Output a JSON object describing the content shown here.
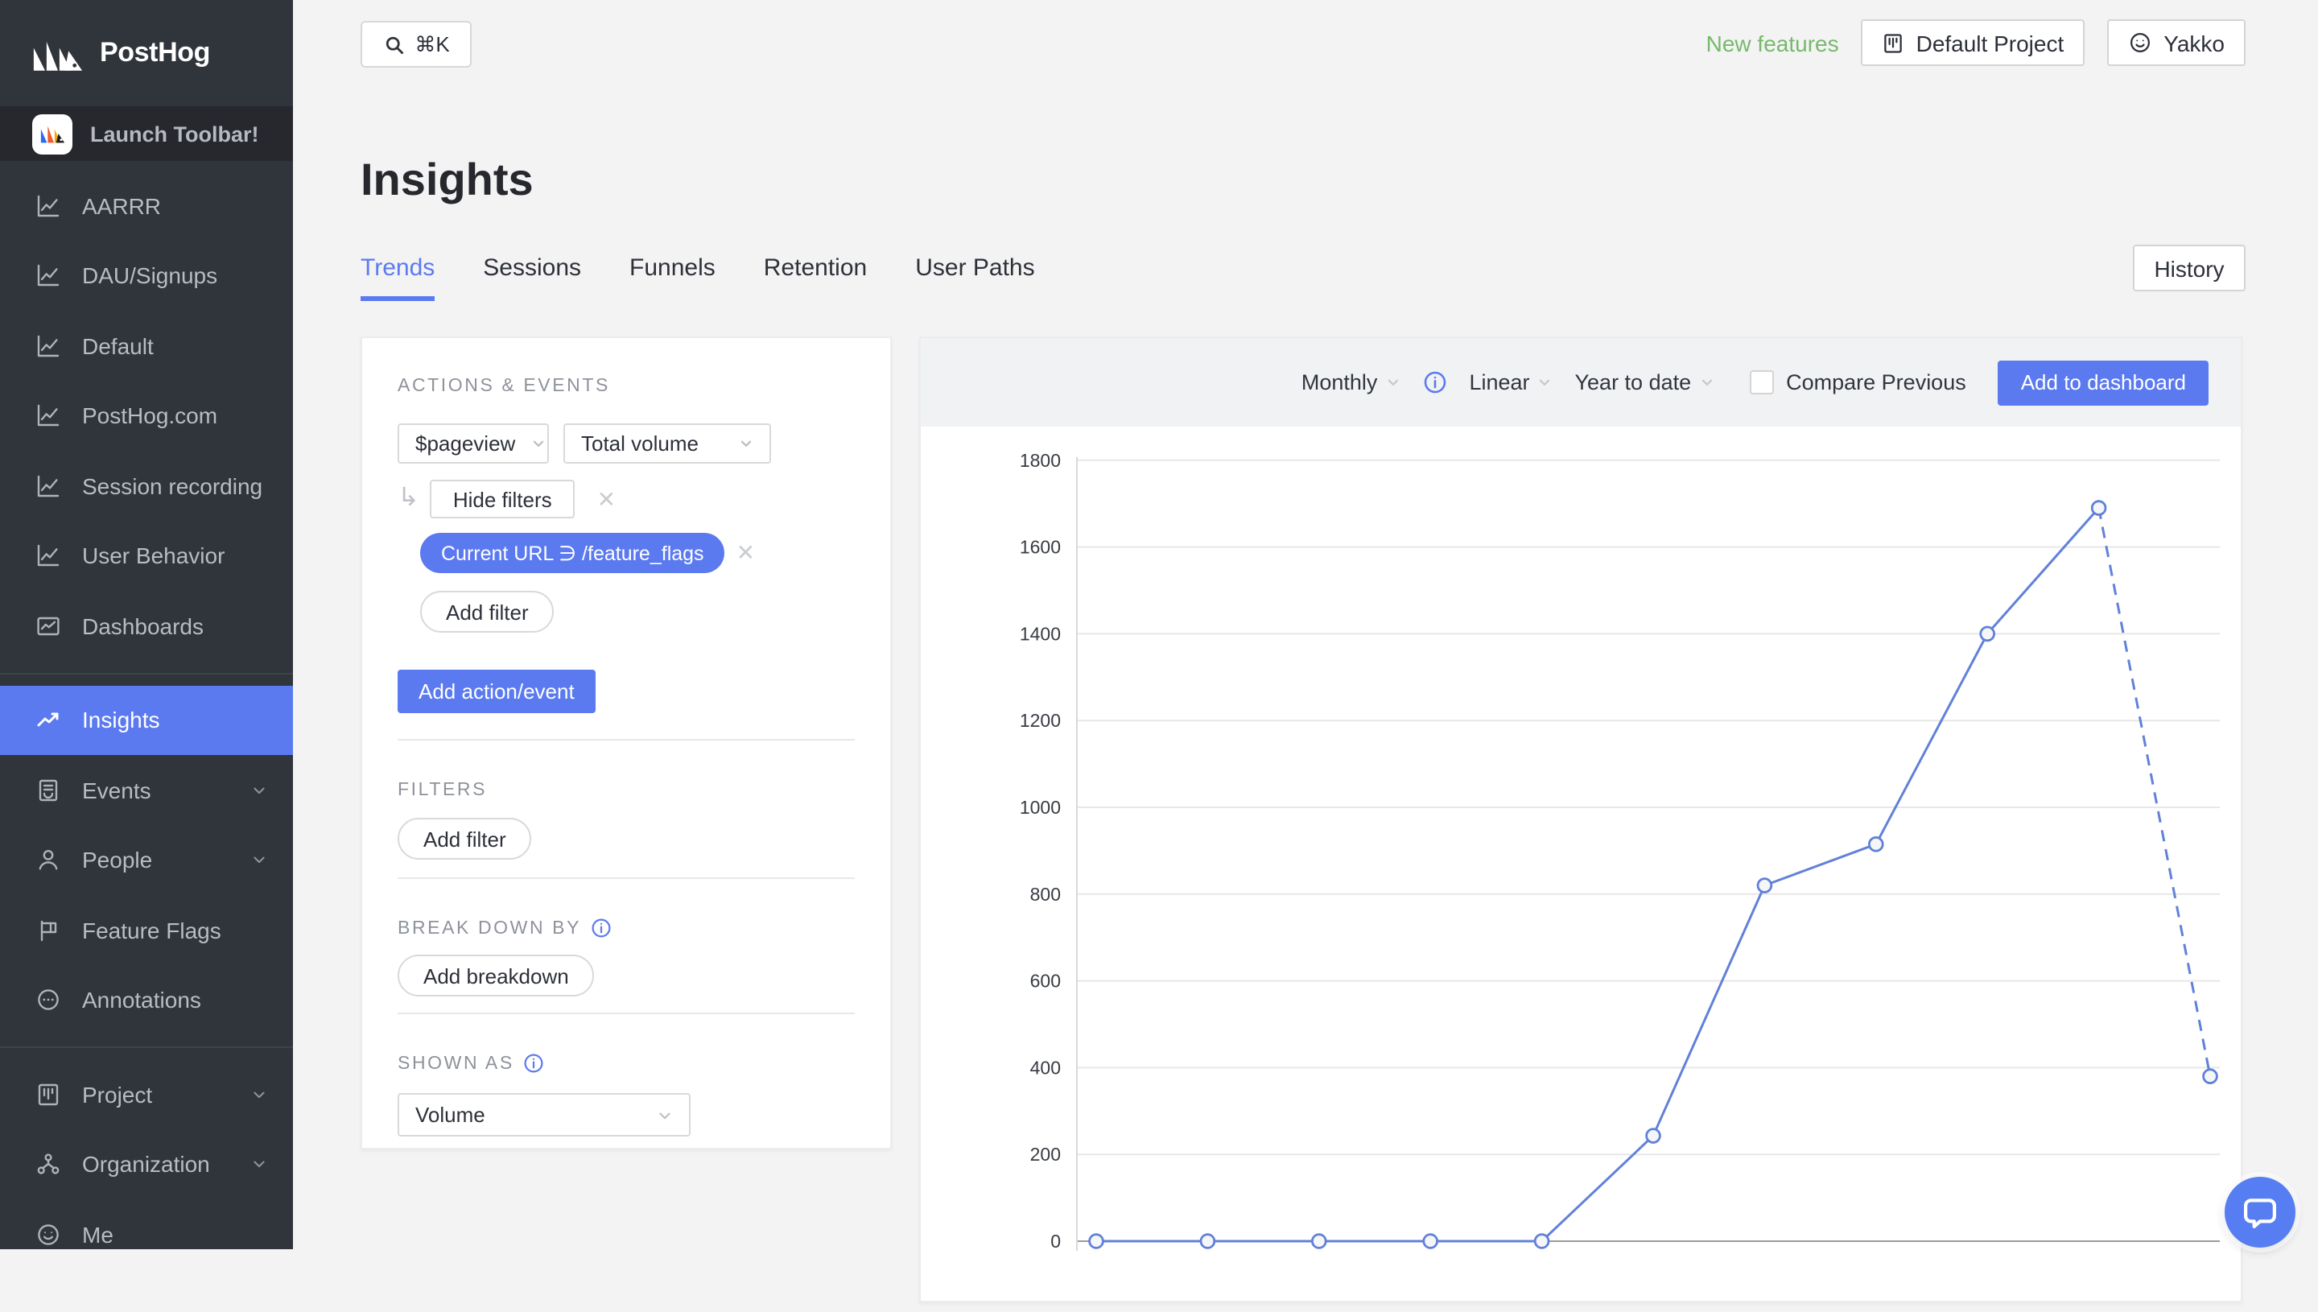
{
  "colors": {
    "accent": "#5b7af0",
    "line": "#6181d9",
    "green": "#77b96b",
    "sidebar_bg": "#30343b",
    "page_bg": "#f3f3f4"
  },
  "app": {
    "logo_text": "PostHog"
  },
  "topbar": {
    "search_shortcut": "⌘K",
    "new_features": "New features",
    "project_button": "Default Project",
    "user_button": "Yakko"
  },
  "sidebar": {
    "launch_toolbar": "Launch Toolbar!",
    "groups": [
      [
        {
          "label": "AARRR",
          "icon": "line-chart"
        },
        {
          "label": "DAU/Signups",
          "icon": "line-chart"
        },
        {
          "label": "Default",
          "icon": "line-chart"
        },
        {
          "label": "PostHog.com",
          "icon": "line-chart"
        },
        {
          "label": "Session recording",
          "icon": "line-chart"
        },
        {
          "label": "User Behavior",
          "icon": "line-chart"
        },
        {
          "label": "Dashboards",
          "icon": "dashboard"
        }
      ],
      [
        {
          "label": "Insights",
          "icon": "trending-up",
          "active": true
        },
        {
          "label": "Events",
          "icon": "container",
          "chevron": true
        },
        {
          "label": "People",
          "icon": "user",
          "chevron": true
        },
        {
          "label": "Feature Flags",
          "icon": "flag"
        },
        {
          "label": "Annotations",
          "icon": "comment"
        }
      ],
      [
        {
          "label": "Project",
          "icon": "project",
          "chevron": true
        },
        {
          "label": "Organization",
          "icon": "cluster",
          "chevron": true
        },
        {
          "label": "Me",
          "icon": "smile"
        }
      ]
    ]
  },
  "page": {
    "title": "Insights",
    "tabs": [
      {
        "label": "Trends",
        "active": true
      },
      {
        "label": "Sessions"
      },
      {
        "label": "Funnels"
      },
      {
        "label": "Retention"
      },
      {
        "label": "User Paths"
      }
    ],
    "history_button": "History"
  },
  "panel": {
    "actions_events_label": "ACTIONS & EVENTS",
    "event_select": "$pageview",
    "math_select": "Total volume",
    "hide_filters": "Hide filters",
    "filter_chip": "Current URL ∋ /feature_flags",
    "add_filter": "Add filter",
    "add_action_event": "Add action/event",
    "filters_label": "FILTERS",
    "add_filter_2": "Add filter",
    "breakdown_label": "BREAK DOWN BY",
    "add_breakdown": "Add breakdown",
    "shown_as_label": "SHOWN AS",
    "shown_as_value": "Volume"
  },
  "chart_controls": {
    "interval": "Monthly",
    "chart_type": "Linear",
    "date_range": "Year to date",
    "compare_label": "Compare Previous",
    "compare_checked": false,
    "add_button": "Add to dashboard"
  },
  "chart_data": {
    "type": "line",
    "title": "$pageview total volume, monthly, year to date",
    "series": [
      {
        "name": "$pageview — Total volume",
        "values": [
          0,
          0,
          0,
          0,
          0,
          243,
          820,
          915,
          1400,
          1690,
          380
        ]
      }
    ],
    "x_labels_visible": false,
    "last_segment_style": "dashed",
    "ylim": [
      0,
      1800
    ],
    "y_ticks": [
      0,
      200,
      400,
      600,
      800,
      1000,
      1200,
      1400,
      1600,
      1800
    ],
    "grid": true,
    "legend": false,
    "line_color": "#6181d9",
    "marker": "open-circle"
  }
}
